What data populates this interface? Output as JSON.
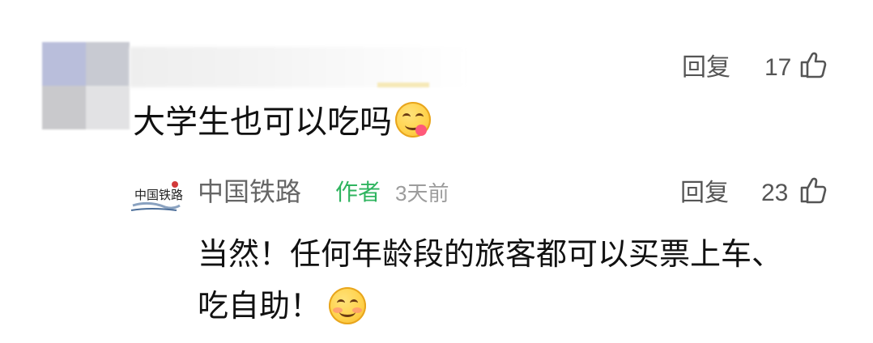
{
  "top_comment": {
    "text": "大学生也可以吃吗",
    "reply_label": "回复",
    "likes": "17",
    "emoji": "yum-face"
  },
  "reply": {
    "author": "中国铁路",
    "author_tag": "作者",
    "time": "3天前",
    "reply_label": "回复",
    "likes": "23",
    "text_line1": "当然！任何年龄段的旅客都可以买票上车、",
    "text_line2": "吃自助！",
    "emoji": "smiling-face",
    "logo_text": "中国铁路"
  },
  "colors": {
    "author_tag": "#2fb45f",
    "meta": "#555555",
    "text": "#111111"
  },
  "icons": [
    "thumbs-up-icon",
    "yum-emoji-icon",
    "smile-emoji-icon",
    "railway-logo"
  ]
}
